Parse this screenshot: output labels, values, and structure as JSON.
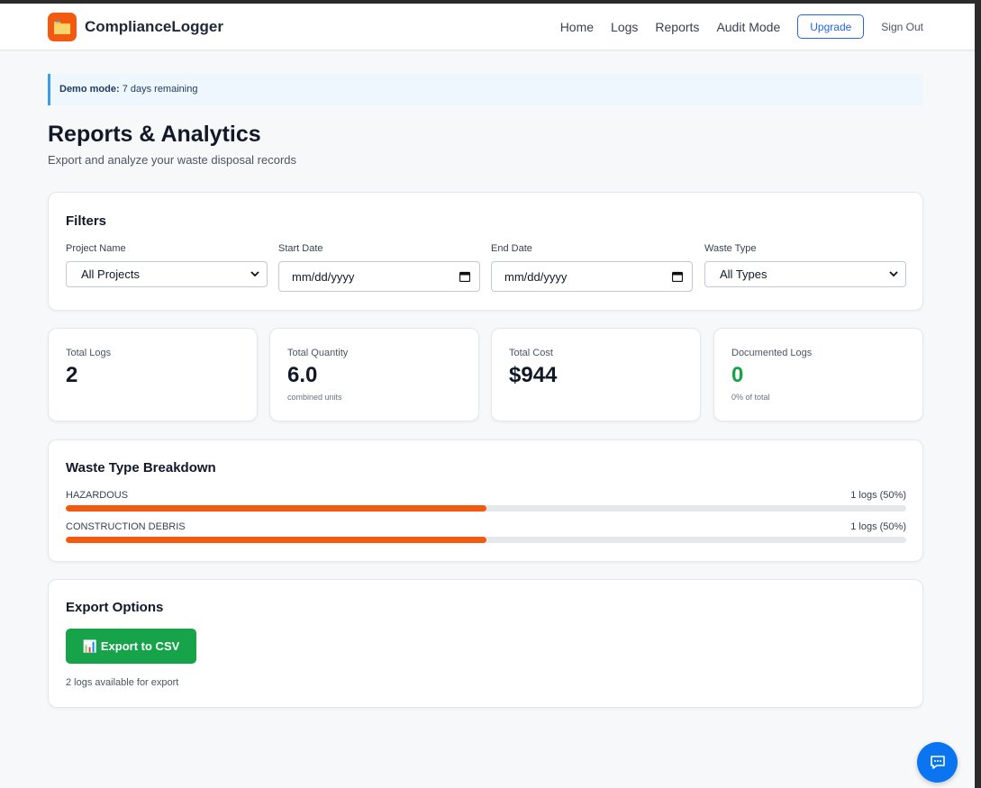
{
  "app": {
    "name": "ComplianceLogger",
    "brand_color": "#f35a10"
  },
  "nav": {
    "items": [
      "Home",
      "Logs",
      "Reports",
      "Audit Mode"
    ],
    "upgrade_label": "Upgrade",
    "signout_label": "Sign Out"
  },
  "banner": {
    "bold": "Demo mode:",
    "text": "7 days remaining"
  },
  "page": {
    "title": "Reports & Analytics",
    "subtitle": "Export and analyze your waste disposal records"
  },
  "filters": {
    "title": "Filters",
    "fields": [
      {
        "label": "Project Name",
        "type": "select",
        "value": "All Projects"
      },
      {
        "label": "Start Date",
        "type": "date",
        "value": "mm/dd/yyyy"
      },
      {
        "label": "End Date",
        "type": "date",
        "value": "mm/dd/yyyy"
      },
      {
        "label": "Waste Type",
        "type": "select",
        "value": "All Types"
      }
    ]
  },
  "stats": [
    {
      "label": "Total Logs",
      "value": "2",
      "note": ""
    },
    {
      "label": "Total Quantity",
      "value": "6.0",
      "note": "combined units"
    },
    {
      "label": "Total Cost",
      "value": "$944",
      "note": ""
    },
    {
      "label": "Documented Logs",
      "value": "0",
      "note": "0% of total",
      "color": "#16a34a"
    }
  ],
  "breakdown": {
    "title": "Waste Type Breakdown",
    "bar_color": "#f35a10",
    "rows": [
      {
        "label": "HAZARDOUS",
        "count_text": "1 logs (50%)",
        "percent": 50
      },
      {
        "label": "CONSTRUCTION DEBRIS",
        "count_text": "1 logs (50%)",
        "percent": 50
      }
    ]
  },
  "export": {
    "title": "Export Options",
    "button_icon": "📊",
    "button_label": "Export to CSV",
    "button_color": "#16a34a",
    "note": "2 logs available for export"
  },
  "chat": {
    "icon": "chat-icon",
    "color": "#0b74f0"
  }
}
